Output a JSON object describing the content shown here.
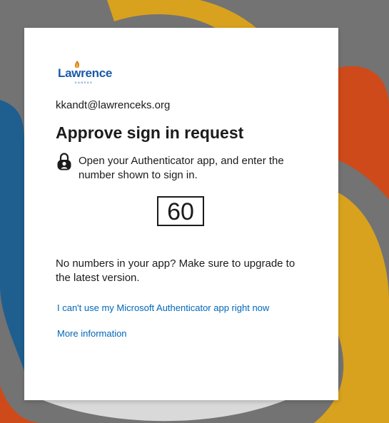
{
  "colors": {
    "page_bg": "#6f6f6f",
    "card_bg": "#ffffff",
    "text": "#1b1b1b",
    "link": "#0067b8",
    "brand_blue": "#1b5aa6",
    "bg_yellow": "#d8a21e",
    "bg_orange": "#cf4a1a",
    "bg_blue": "#1f5f8f"
  },
  "logo": {
    "word": "Lawrence",
    "sub": "KANSAS",
    "icon": "flame-icon"
  },
  "account": {
    "email": "kkandt@lawrenceks.org"
  },
  "main": {
    "title": "Approve sign in request",
    "instruction_icon": "authenticator-lock-icon",
    "instruction": "Open your Authenticator app, and enter the number shown to sign in.",
    "number": "60",
    "note": "No numbers in your app? Make sure to upgrade to the latest version."
  },
  "links": {
    "cant_use": "I can't use my Microsoft Authenticator app right now",
    "more_info": "More information"
  }
}
